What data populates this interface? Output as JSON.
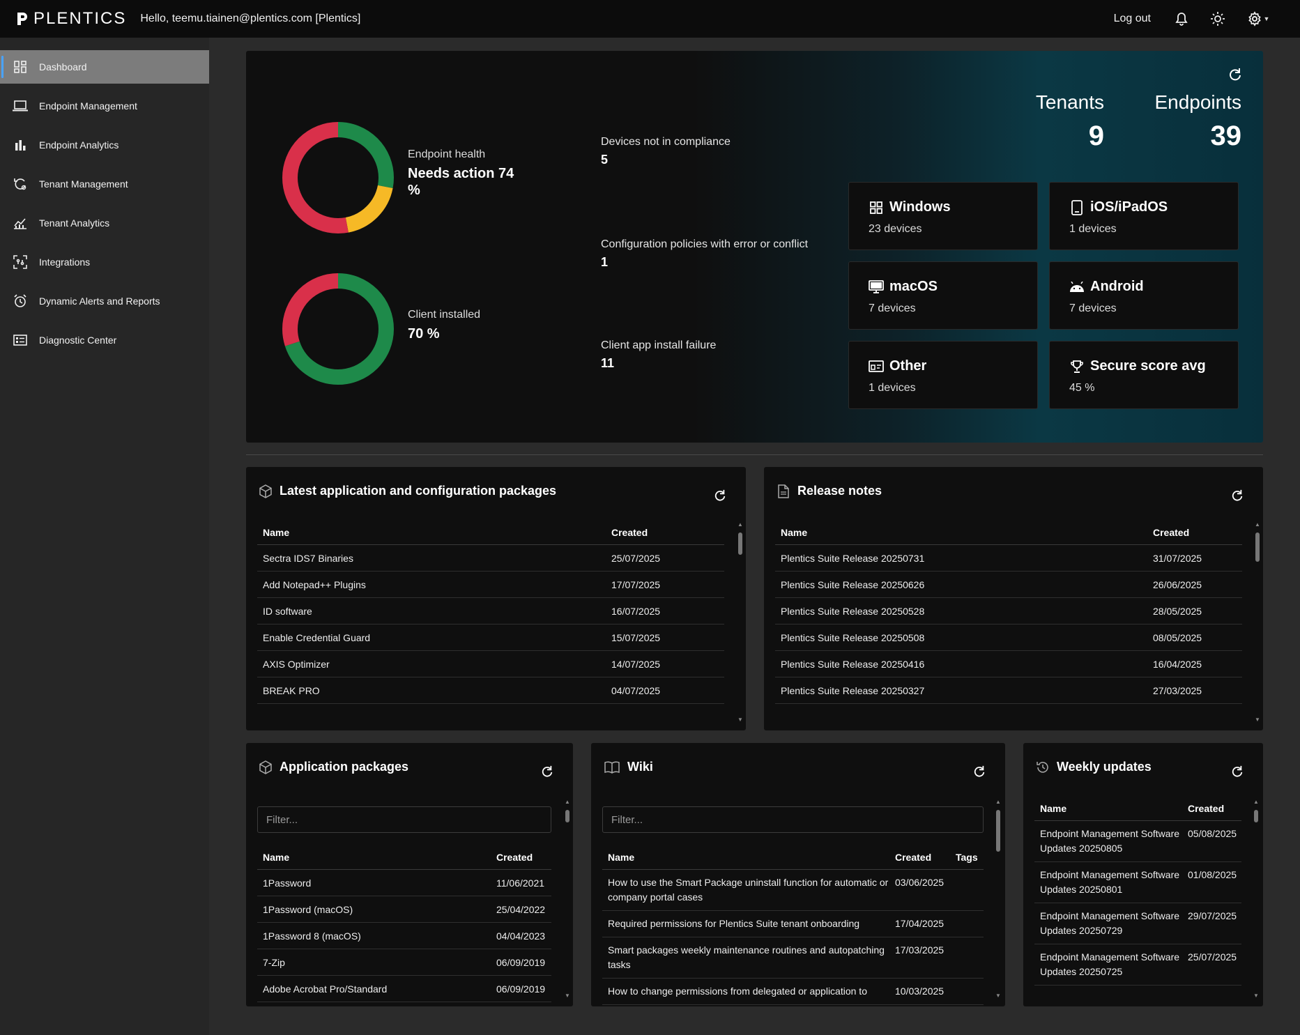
{
  "topbar": {
    "logo": "PLENTICS",
    "greeting": "Hello, teemu.tiainen@plentics.com [Plentics]",
    "logout": "Log out"
  },
  "sidebar": {
    "items": [
      {
        "label": "Dashboard",
        "icon": "dashboard-icon",
        "active": true
      },
      {
        "label": "Endpoint Management",
        "icon": "laptop-icon"
      },
      {
        "label": "Endpoint Analytics",
        "icon": "bar-chart-icon"
      },
      {
        "label": "Tenant Management",
        "icon": "tenant-settings-icon"
      },
      {
        "label": "Tenant Analytics",
        "icon": "line-chart-icon"
      },
      {
        "label": "Integrations",
        "icon": "integrations-icon"
      },
      {
        "label": "Dynamic Alerts and Reports",
        "icon": "alarm-clock-icon"
      },
      {
        "label": "Diagnostic Center",
        "icon": "diagnostic-list-icon"
      }
    ]
  },
  "hero": {
    "endpoint_health": {
      "label": "Endpoint health",
      "value": "Needs action 74 %",
      "segments": {
        "green": 0.28,
        "yellow": 0.19,
        "red": 0.53
      }
    },
    "client_installed": {
      "label": "Client installed",
      "value": "70 %",
      "segments": {
        "green": 0.7,
        "red": 0.3
      }
    },
    "metrics": [
      {
        "label": "Devices not in compliance",
        "value": "5"
      },
      {
        "label": "Configuration policies with error or conflict",
        "value": "1"
      },
      {
        "label": "Client app install failure",
        "value": "11"
      }
    ],
    "tenants": {
      "label": "Tenants",
      "value": "9"
    },
    "endpoints": {
      "label": "Endpoints",
      "value": "39"
    },
    "cards": [
      {
        "title": "Windows",
        "sub": "23 devices",
        "icon": "windows-icon"
      },
      {
        "title": "iOS/iPadOS",
        "sub": "1 devices",
        "icon": "tablet-icon"
      },
      {
        "title": "macOS",
        "sub": "7 devices",
        "icon": "desktop-icon"
      },
      {
        "title": "Android",
        "sub": "7 devices",
        "icon": "android-icon"
      },
      {
        "title": "Other",
        "sub": "1 devices",
        "icon": "other-device-icon"
      },
      {
        "title": "Secure score avg",
        "sub": "45 %",
        "icon": "trophy-icon"
      }
    ],
    "colors": {
      "green": "#1e8a4a",
      "yellow": "#f6b926",
      "red": "#d9304a"
    }
  },
  "latest_packages": {
    "title": "Latest application and configuration packages",
    "headers": [
      "Name",
      "Created"
    ],
    "rows": [
      [
        "Sectra IDS7 Binaries",
        "25/07/2025"
      ],
      [
        "Add Notepad++ Plugins",
        "17/07/2025"
      ],
      [
        "ID software",
        "16/07/2025"
      ],
      [
        "Enable Credential Guard",
        "15/07/2025"
      ],
      [
        "AXIS Optimizer",
        "14/07/2025"
      ],
      [
        "BREAK PRO",
        "04/07/2025"
      ]
    ]
  },
  "release_notes": {
    "title": "Release notes",
    "headers": [
      "Name",
      "Created"
    ],
    "rows": [
      [
        "Plentics Suite Release 20250731",
        "31/07/2025"
      ],
      [
        "Plentics Suite Release 20250626",
        "26/06/2025"
      ],
      [
        "Plentics Suite Release 20250528",
        "28/05/2025"
      ],
      [
        "Plentics Suite Release 20250508",
        "08/05/2025"
      ],
      [
        "Plentics Suite Release 20250416",
        "16/04/2025"
      ],
      [
        "Plentics Suite Release 20250327",
        "27/03/2025"
      ]
    ]
  },
  "app_packages": {
    "title": "Application packages",
    "filter_placeholder": "Filter...",
    "headers": [
      "Name",
      "Created"
    ],
    "rows": [
      [
        "1Password",
        "11/06/2021"
      ],
      [
        "1Password (macOS)",
        "25/04/2022"
      ],
      [
        "1Password 8 (macOS)",
        "04/04/2023"
      ],
      [
        "7-Zip",
        "06/09/2019"
      ],
      [
        "Adobe Acrobat Pro/Standard",
        "06/09/2019"
      ]
    ]
  },
  "wiki": {
    "title": "Wiki",
    "filter_placeholder": "Filter...",
    "headers": [
      "Name",
      "Created",
      "Tags"
    ],
    "rows": [
      [
        "How to use the Smart Package uninstall function for automatic or company portal cases",
        "03/06/2025",
        ""
      ],
      [
        "Required permissions for Plentics Suite tenant onboarding",
        "17/04/2025",
        ""
      ],
      [
        "Smart packages weekly maintenance routines and autopatching tasks",
        "17/03/2025",
        ""
      ],
      [
        "How to change permissions from delegated or application to",
        "10/03/2025",
        ""
      ]
    ]
  },
  "weekly_updates": {
    "title": "Weekly updates",
    "headers": [
      "Name",
      "Created"
    ],
    "rows": [
      [
        "Endpoint Management Software Updates 20250805",
        "05/08/2025"
      ],
      [
        "Endpoint Management Software Updates 20250801",
        "01/08/2025"
      ],
      [
        "Endpoint Management Software Updates 20250729",
        "29/07/2025"
      ],
      [
        "Endpoint Management Software Updates 20250725",
        "25/07/2025"
      ]
    ]
  }
}
